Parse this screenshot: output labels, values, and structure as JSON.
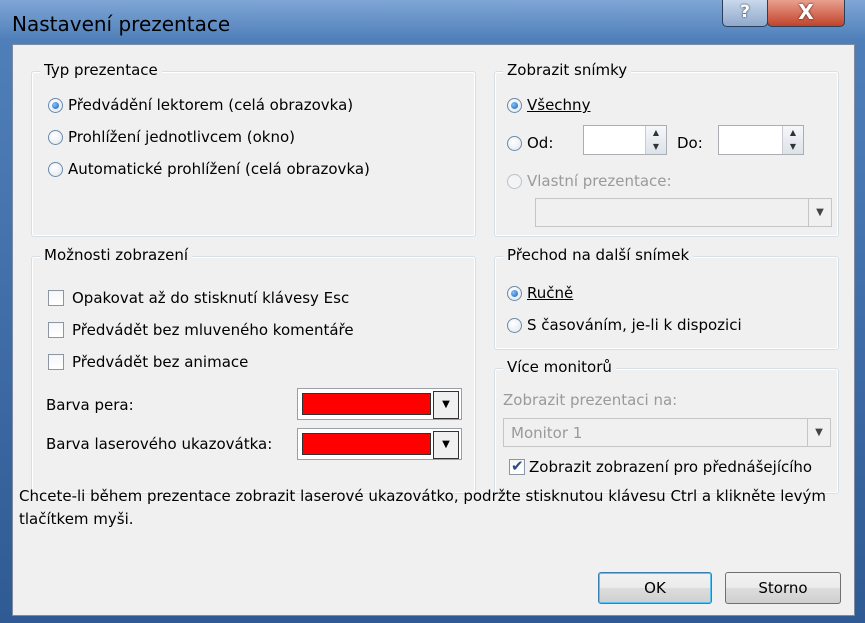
{
  "window": {
    "title": "Nastavení prezentace",
    "help_label": "?",
    "close_label": "X"
  },
  "typ": {
    "legend": "Typ prezentace",
    "options": [
      {
        "label": "Předvádění lektorem (celá obrazovka)",
        "selected": true
      },
      {
        "label": "Prohlížení jednotlivcem (okno)",
        "selected": false
      },
      {
        "label": "Automatické prohlížení (celá obrazovka)",
        "selected": false
      }
    ]
  },
  "zobrazit": {
    "legend": "Zobrazit snímky",
    "vsechny": "Všechny",
    "od": "Od:",
    "do": "Do:",
    "vlastni": "Vlastní prezentace:",
    "od_value": "",
    "do_value": "",
    "vlastni_value": ""
  },
  "moznosti": {
    "legend": "Možnosti zobrazení",
    "checks": [
      {
        "label": "Opakovat až do stisknutí klávesy Esc",
        "checked": false
      },
      {
        "label": "Předvádět bez mluveného komentáře",
        "checked": false
      },
      {
        "label": "Předvádět bez animace",
        "checked": false
      }
    ],
    "pen_label": "Barva pera:",
    "laser_label": "Barva laserového ukazovátka:",
    "pen_color": "#ff0000",
    "laser_color": "#ff0000"
  },
  "prechod": {
    "legend": "Přechod na další snímek",
    "rucne": "Ručně",
    "casovani": "S časováním, je-li k dispozici"
  },
  "monitory": {
    "legend": "Více monitorů",
    "label": "Zobrazit prezentaci na:",
    "monitor": "Monitor 1",
    "presenter": "Zobrazit zobrazení pro přednášejícího",
    "presenter_checked": true
  },
  "note": "Chcete-li během prezentace zobrazit laserové ukazovátko, podržte stisknutou klávesu Ctrl a klikněte levým tlačítkem myši.",
  "buttons": {
    "ok": "OK",
    "cancel": "Storno"
  }
}
